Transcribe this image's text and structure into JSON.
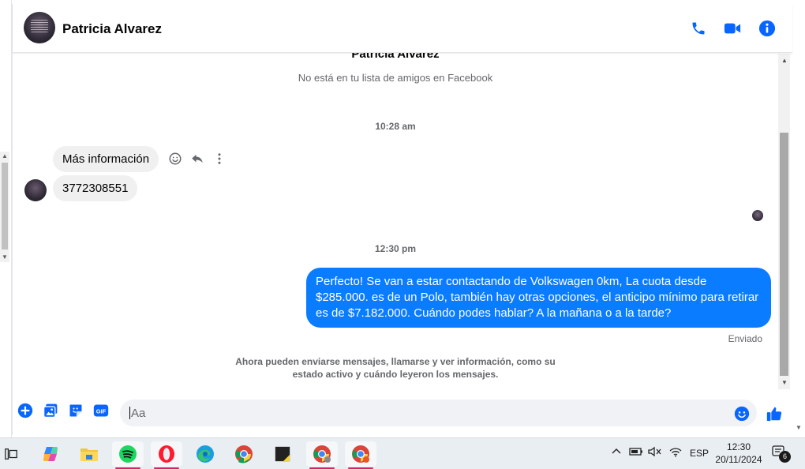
{
  "header": {
    "contact_name": "Patricia Alvarez"
  },
  "intro": {
    "name": "Patricia Alvarez",
    "subtitle": "No está en tu lista de amigos en Facebook"
  },
  "messages": {
    "time1": "10:28 am",
    "in1": "Más información",
    "in2": "3772308551",
    "time2": "12:30 pm",
    "out1": "Perfecto!  Se van a estar contactando de Volkswagen 0km, La cuota desde $285.000. es de un Polo, también hay otras opciones, el anticipo mínimo para retirar es de $7.182.000. Cuándo podes hablar? A la mañana o a la tarde?",
    "status": "Enviado",
    "notice": "Ahora pueden enviarse mensajes, llamarse y ver información, como su estado activo y cuándo leyeron los mensajes."
  },
  "composer": {
    "placeholder": "Aa",
    "gif_label": "GIF"
  },
  "colors": {
    "accent": "#0a7cff",
    "icon_blue": "#0866ff"
  },
  "taskbar": {
    "language": "ESP",
    "time": "12:30",
    "date": "20/11/2024",
    "notifications": "6"
  }
}
